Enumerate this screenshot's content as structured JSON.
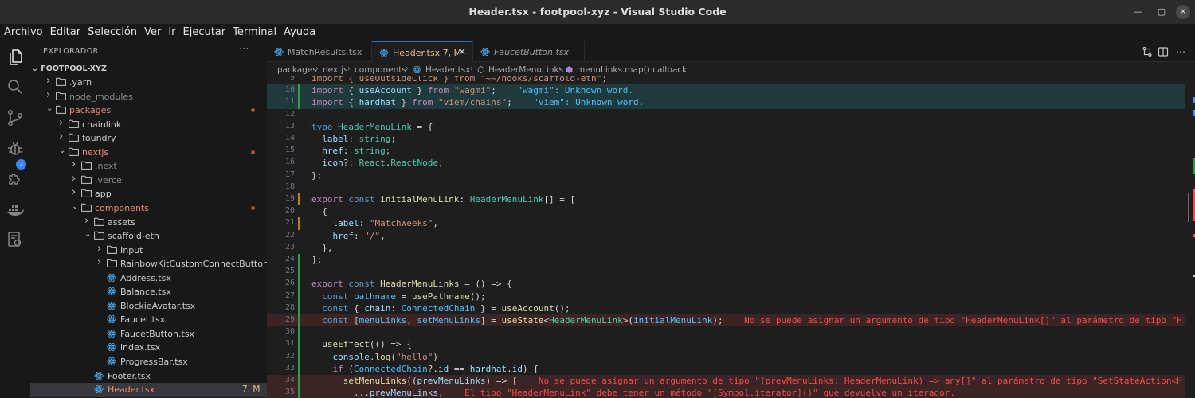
{
  "window": {
    "title": "Header.tsx - footpool-xyz - Visual Studio Code",
    "minimize": "—",
    "maximize": "▢",
    "close": "✕"
  },
  "menu": [
    "Archivo",
    "Editar",
    "Selección",
    "Ver",
    "Ir",
    "Ejecutar",
    "Terminal",
    "Ayuda"
  ],
  "activity_badge": "2",
  "explorer": {
    "heading": "EXPLORADOR",
    "more": "···",
    "root": "FOOTPOOL-XYZ",
    "items": [
      {
        "label": "yarn",
        "prefix": ".",
        "kind": "folder",
        "depth": 1,
        "open": false,
        "color": "#cccccc"
      },
      {
        "label": "node_modules",
        "kind": "folder",
        "depth": 1,
        "open": false,
        "color": "#8b8b8b"
      },
      {
        "label": "packages",
        "kind": "folder",
        "depth": 1,
        "open": true,
        "color": "#e98a72",
        "dot": true
      },
      {
        "label": "chainlink",
        "kind": "folder",
        "depth": 2,
        "open": false,
        "color": "#cccccc"
      },
      {
        "label": "foundry",
        "kind": "folder",
        "depth": 2,
        "open": false,
        "color": "#cccccc"
      },
      {
        "label": "nextjs",
        "kind": "folder",
        "depth": 2,
        "open": true,
        "color": "#e98a72",
        "dot": true
      },
      {
        "label": ".next",
        "kind": "folder",
        "depth": 3,
        "open": false,
        "color": "#8b8b8b"
      },
      {
        "label": ".vercel",
        "kind": "folder",
        "depth": 3,
        "open": false,
        "color": "#8b8b8b"
      },
      {
        "label": "app",
        "kind": "folder",
        "depth": 3,
        "open": false,
        "color": "#cccccc"
      },
      {
        "label": "components",
        "kind": "folder",
        "depth": 3,
        "open": true,
        "color": "#e98a72",
        "dot": true
      },
      {
        "label": "assets",
        "kind": "folder",
        "depth": 4,
        "open": false,
        "color": "#cccccc"
      },
      {
        "label": "scaffold-eth",
        "kind": "folder",
        "depth": 4,
        "open": true,
        "color": "#cccccc"
      },
      {
        "label": "Input",
        "kind": "folder",
        "depth": 5,
        "open": false,
        "color": "#cccccc"
      },
      {
        "label": "RainbowKitCustomConnectButton",
        "kind": "folder",
        "depth": 5,
        "open": false,
        "color": "#cccccc"
      },
      {
        "label": "Address.tsx",
        "kind": "file",
        "depth": 5,
        "color": "#cccccc"
      },
      {
        "label": "Balance.tsx",
        "kind": "file",
        "depth": 5,
        "color": "#cccccc"
      },
      {
        "label": "BlockieAvatar.tsx",
        "kind": "file",
        "depth": 5,
        "color": "#cccccc"
      },
      {
        "label": "Faucet.tsx",
        "kind": "file",
        "depth": 5,
        "color": "#cccccc"
      },
      {
        "label": "FaucetButton.tsx",
        "kind": "file",
        "depth": 5,
        "color": "#cccccc"
      },
      {
        "label": "index.tsx",
        "kind": "file",
        "depth": 5,
        "color": "#cccccc"
      },
      {
        "label": "ProgressBar.tsx",
        "kind": "file",
        "depth": 5,
        "color": "#cccccc"
      },
      {
        "label": "Footer.tsx",
        "kind": "file",
        "depth": 4,
        "color": "#cccccc"
      },
      {
        "label": "Header.tsx",
        "kind": "file",
        "depth": 4,
        "color": "#e98a72",
        "selected": true,
        "status": "7, M"
      }
    ]
  },
  "tabs": [
    {
      "label": "MatchResults.tsx",
      "active": false,
      "italic": false
    },
    {
      "label": "Header.tsx 7, M",
      "active": true,
      "italic": false,
      "close": "✕"
    },
    {
      "label": "FaucetButton.tsx",
      "active": false,
      "italic": true
    }
  ],
  "breadcrumb": [
    "packages",
    "nextjs",
    "components",
    "Header.tsx",
    "HeaderMenuLinks",
    "menuLinks.map() callback"
  ],
  "editor": {
    "lines": [
      {
        "n": "9",
        "bg": "",
        "gutter": "",
        "tokens": [
          [
            "import { useOutsideClick } from \"~~/hooks/scaffold-eth\";",
            "#ce9178"
          ]
        ]
      },
      {
        "n": "10",
        "bg": "green",
        "gutter": "g",
        "tokens": [
          [
            "import",
            "#c586c0"
          ],
          [
            " { ",
            "#d4d4d4"
          ],
          [
            "useAccount",
            "#9cdcfe"
          ],
          [
            " } ",
            "#d4d4d4"
          ],
          [
            "from",
            "#c586c0"
          ],
          [
            " ",
            "#d4d4d4"
          ],
          [
            "\"wagmi\"",
            "#ce9178"
          ],
          [
            ";",
            "#d4d4d4"
          ],
          [
            "    \"wagmi\": Unknown word.",
            "#4fc1ff"
          ]
        ]
      },
      {
        "n": "11",
        "bg": "green",
        "gutter": "g",
        "tokens": [
          [
            "import",
            "#c586c0"
          ],
          [
            " { ",
            "#d4d4d4"
          ],
          [
            "hardhat",
            "#9cdcfe"
          ],
          [
            " } ",
            "#d4d4d4"
          ],
          [
            "from",
            "#c586c0"
          ],
          [
            " ",
            "#d4d4d4"
          ],
          [
            "\"viem/chains\"",
            "#ce9178"
          ],
          [
            ";",
            "#d4d4d4"
          ],
          [
            "    \"viem\": Unknown word.",
            "#4fc1ff"
          ]
        ]
      },
      {
        "n": "12",
        "bg": "",
        "gutter": "",
        "tokens": [
          [
            "",
            "#d4d4d4"
          ]
        ]
      },
      {
        "n": "13",
        "bg": "",
        "gutter": "",
        "tokens": [
          [
            "type",
            "#569cd6"
          ],
          [
            " ",
            "#d4d4d4"
          ],
          [
            "HeaderMenuLink",
            "#4ec9b0"
          ],
          [
            " = {",
            "#d4d4d4"
          ]
        ]
      },
      {
        "n": "14",
        "bg": "",
        "gutter": "",
        "tokens": [
          [
            "  ",
            "#d4d4d4"
          ],
          [
            "label",
            "#9cdcfe"
          ],
          [
            ": ",
            "#d4d4d4"
          ],
          [
            "string",
            "#4ec9b0"
          ],
          [
            ";",
            "#d4d4d4"
          ]
        ]
      },
      {
        "n": "15",
        "bg": "",
        "gutter": "",
        "tokens": [
          [
            "  ",
            "#d4d4d4"
          ],
          [
            "href",
            "#9cdcfe"
          ],
          [
            ": ",
            "#d4d4d4"
          ],
          [
            "string",
            "#4ec9b0"
          ],
          [
            ";",
            "#d4d4d4"
          ]
        ]
      },
      {
        "n": "16",
        "bg": "",
        "gutter": "",
        "tokens": [
          [
            "  ",
            "#d4d4d4"
          ],
          [
            "icon",
            "#9cdcfe"
          ],
          [
            "?: ",
            "#d4d4d4"
          ],
          [
            "React",
            "#4ec9b0"
          ],
          [
            ".",
            "#d4d4d4"
          ],
          [
            "ReactNode",
            "#4ec9b0"
          ],
          [
            ";",
            "#d4d4d4"
          ]
        ]
      },
      {
        "n": "17",
        "bg": "",
        "gutter": "",
        "tokens": [
          [
            "};",
            "#d4d4d4"
          ]
        ]
      },
      {
        "n": "18",
        "bg": "",
        "gutter": "",
        "tokens": [
          [
            "",
            "#d4d4d4"
          ]
        ]
      },
      {
        "n": "19",
        "bg": "",
        "gutter": "y",
        "tokens": [
          [
            "export",
            "#c586c0"
          ],
          [
            " ",
            "#d4d4d4"
          ],
          [
            "const",
            "#569cd6"
          ],
          [
            " ",
            "#d4d4d4"
          ],
          [
            "initialMenuLink",
            "#dcdcaa"
          ],
          [
            ": ",
            "#d4d4d4"
          ],
          [
            "HeaderMenuLink",
            "#4ec9b0"
          ],
          [
            "[] = [",
            "#d4d4d4"
          ]
        ]
      },
      {
        "n": "20",
        "bg": "",
        "gutter": "",
        "tokens": [
          [
            "  {",
            "#d4d4d4"
          ]
        ]
      },
      {
        "n": "21",
        "bg": "",
        "gutter": "y",
        "tokens": [
          [
            "    ",
            "#d4d4d4"
          ],
          [
            "label",
            "#9cdcfe"
          ],
          [
            ": ",
            "#d4d4d4"
          ],
          [
            "\"MatchWeeks\"",
            "#ce9178"
          ],
          [
            ",",
            "#d4d4d4"
          ]
        ]
      },
      {
        "n": "22",
        "bg": "",
        "gutter": "",
        "tokens": [
          [
            "    ",
            "#d4d4d4"
          ],
          [
            "href",
            "#9cdcfe"
          ],
          [
            ": ",
            "#d4d4d4"
          ],
          [
            "\"/\"",
            "#ce9178"
          ],
          [
            ",",
            "#d4d4d4"
          ]
        ]
      },
      {
        "n": "23",
        "bg": "",
        "gutter": "",
        "tokens": [
          [
            "  },",
            "#d4d4d4"
          ]
        ]
      },
      {
        "n": "24",
        "bg": "",
        "gutter": "g",
        "tokens": [
          [
            "];",
            "#d4d4d4"
          ]
        ]
      },
      {
        "n": "25",
        "bg": "",
        "gutter": "g",
        "tokens": [
          [
            "",
            "#d4d4d4"
          ]
        ]
      },
      {
        "n": "26",
        "bg": "",
        "gutter": "g",
        "tokens": [
          [
            "export",
            "#c586c0"
          ],
          [
            " ",
            "#d4d4d4"
          ],
          [
            "const",
            "#569cd6"
          ],
          [
            " ",
            "#d4d4d4"
          ],
          [
            "HeaderMenuLinks",
            "#dcdcaa"
          ],
          [
            " = () => {",
            "#d4d4d4"
          ]
        ]
      },
      {
        "n": "27",
        "bg": "",
        "gutter": "g",
        "tokens": [
          [
            "  ",
            "#d4d4d4"
          ],
          [
            "const",
            "#569cd6"
          ],
          [
            " ",
            "#d4d4d4"
          ],
          [
            "pathname",
            "#4fc1ff"
          ],
          [
            " = ",
            "#d4d4d4"
          ],
          [
            "usePathname",
            "#dcdcaa"
          ],
          [
            "();",
            "#d4d4d4"
          ]
        ]
      },
      {
        "n": "28",
        "bg": "",
        "gutter": "g",
        "tokens": [
          [
            "  ",
            "#d4d4d4"
          ],
          [
            "const",
            "#569cd6"
          ],
          [
            " { ",
            "#d4d4d4"
          ],
          [
            "chain",
            "#9cdcfe"
          ],
          [
            ": ",
            "#d4d4d4"
          ],
          [
            "ConnectedChain",
            "#4fc1ff"
          ],
          [
            " } = ",
            "#d4d4d4"
          ],
          [
            "useAccount",
            "#dcdcaa"
          ],
          [
            "();",
            "#d4d4d4"
          ]
        ]
      },
      {
        "n": "29",
        "bg": "red",
        "gutter": "g",
        "tokens": [
          [
            "  ",
            "#d4d4d4"
          ],
          [
            "const",
            "#569cd6"
          ],
          [
            " [",
            "#d4d4d4"
          ],
          [
            "menuLinks",
            "#4fc1ff"
          ],
          [
            ", ",
            "#d4d4d4"
          ],
          [
            "setMenuLinks",
            "#4fc1ff"
          ],
          [
            "] = ",
            "#d4d4d4"
          ],
          [
            "useState",
            "#dcdcaa"
          ],
          [
            "<",
            "#d4d4d4"
          ],
          [
            "HeaderMenuLink",
            "#4ec9b0"
          ],
          [
            ">(",
            "#d4d4d4"
          ],
          [
            "initialMenuLink",
            "#4fc1ff"
          ],
          [
            ");",
            "#d4d4d4"
          ],
          [
            "    No se puede asignar un argumento de tipo \"HeaderMenuLink[]\" al parámetro de tipo \"H",
            "#f14c4c"
          ]
        ]
      },
      {
        "n": "30",
        "bg": "",
        "gutter": "g",
        "tokens": [
          [
            "",
            "#d4d4d4"
          ]
        ]
      },
      {
        "n": "31",
        "bg": "",
        "gutter": "g",
        "tokens": [
          [
            "  ",
            "#d4d4d4"
          ],
          [
            "useEffect",
            "#dcdcaa"
          ],
          [
            "(() => {",
            "#d4d4d4"
          ]
        ]
      },
      {
        "n": "32",
        "bg": "",
        "gutter": "g",
        "tokens": [
          [
            "    ",
            "#d4d4d4"
          ],
          [
            "console",
            "#9cdcfe"
          ],
          [
            ".",
            "#d4d4d4"
          ],
          [
            "log",
            "#dcdcaa"
          ],
          [
            "(",
            "#d4d4d4"
          ],
          [
            "\"hello\"",
            "#ce9178"
          ],
          [
            ")",
            "#d4d4d4"
          ]
        ]
      },
      {
        "n": "33",
        "bg": "",
        "gutter": "g",
        "tokens": [
          [
            "    ",
            "#d4d4d4"
          ],
          [
            "if",
            "#c586c0"
          ],
          [
            " (",
            "#d4d4d4"
          ],
          [
            "ConnectedChain",
            "#4fc1ff"
          ],
          [
            "?.",
            "#d4d4d4"
          ],
          [
            "id",
            "#9cdcfe"
          ],
          [
            " == ",
            "#d4d4d4"
          ],
          [
            "hardhat",
            "#9cdcfe"
          ],
          [
            ".",
            "#d4d4d4"
          ],
          [
            "id",
            "#9cdcfe"
          ],
          [
            ") {",
            "#d4d4d4"
          ]
        ]
      },
      {
        "n": "34",
        "bg": "red",
        "gutter": "g",
        "tokens": [
          [
            "      ",
            "#d4d4d4"
          ],
          [
            "setMenuLinks",
            "#dcdcaa"
          ],
          [
            "((",
            "#d4d4d4"
          ],
          [
            "prevMenuLinks",
            "#9cdcfe"
          ],
          [
            ") => [",
            "#d4d4d4"
          ],
          [
            "    No se puede asignar un argumento de tipo \"(prevMenuLinks: HeaderMenuLink) => any[]\" al parámetro de tipo \"SetStateAction<H",
            "#f14c4c"
          ]
        ]
      },
      {
        "n": "35",
        "bg": "red",
        "gutter": "g",
        "tokens": [
          [
            "        ...",
            "#d4d4d4"
          ],
          [
            "prevMenuLinks",
            "#9cdcfe"
          ],
          [
            ",",
            "#d4d4d4"
          ],
          [
            "    El tipo \"HeaderMenuLink\" debe tener un método \"[Symbol.iterator]()\" que devuelve un iterador.",
            "#f14c4c"
          ]
        ]
      }
    ]
  },
  "colors": {
    "accent": "#0078d4",
    "modified": "#e2c08d",
    "git_changed": "#e98a72",
    "error": "#f14c4c",
    "added_gutter": "#2ea043"
  }
}
